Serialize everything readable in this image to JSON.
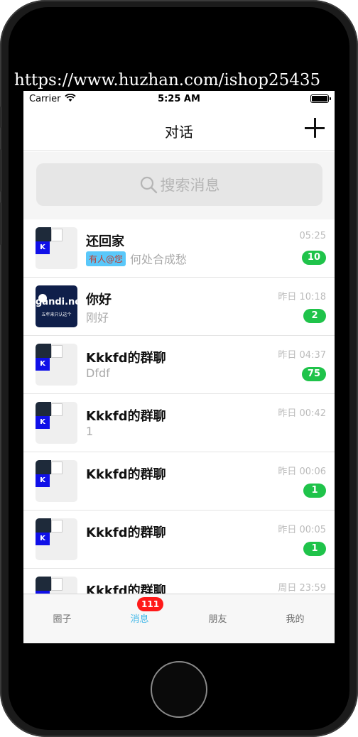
{
  "watermark": "https://www.huzhan.com/ishop25435",
  "status_bar": {
    "carrier": "Carrier",
    "time": "5:25 AM"
  },
  "nav": {
    "title": "对话"
  },
  "search": {
    "placeholder": "搜索消息"
  },
  "chats": [
    {
      "name": "还回家",
      "mention": "有人@您",
      "preview": "何处合成愁",
      "time": "05:25",
      "unread": "10"
    },
    {
      "name": "你好",
      "preview": "刚好",
      "time": "昨日 10:18",
      "unread": "2"
    },
    {
      "name": "Kkkfd的群聊",
      "preview": "Dfdf",
      "time": "昨日 04:37",
      "unread": "75"
    },
    {
      "name": "Kkkfd的群聊",
      "preview": "1",
      "time": "昨日 00:42"
    },
    {
      "name": "Kkkfd的群聊",
      "preview": "",
      "time": "昨日 00:06",
      "unread": "1"
    },
    {
      "name": "Kkkfd的群聊",
      "preview": "",
      "time": "昨日 00:05",
      "unread": "1"
    },
    {
      "name": "Kkkfd的群聊",
      "preview": "",
      "time": "周日 23:59"
    }
  ],
  "avatar_gandi": {
    "brand": "gandi.net",
    "caption": "五年来只认这个"
  },
  "avatar_group_letter": "K",
  "tabs": [
    {
      "label": "圈子"
    },
    {
      "label": "消息",
      "badge": "111"
    },
    {
      "label": "朋友"
    },
    {
      "label": "我的"
    }
  ],
  "colors": {
    "accent_blue": "#3fb7e8",
    "unread_green": "#1fc34a",
    "badge_red": "#ff1a1a"
  }
}
